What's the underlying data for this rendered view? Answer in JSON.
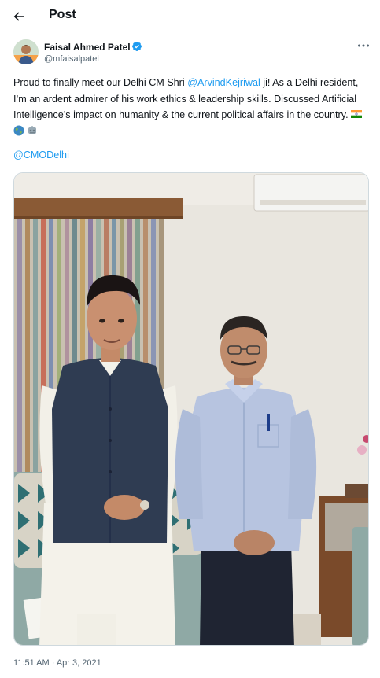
{
  "header": {
    "title": "Post",
    "back_icon": "arrow-left-icon"
  },
  "author": {
    "display_name": "Faisal Ahmed Patel",
    "handle": "@mfaisalpatel",
    "verified_icon": "verified-badge-icon",
    "verified_color": "#1d9bf0",
    "more_icon": "more-horizontal-icon"
  },
  "post": {
    "text_part1": "Proud to finally meet our Delhi CM Shri ",
    "mention1": "@ArvindKejriwal",
    "text_part2": " ji! As a Delhi resident, I’m an ardent admirer of his work ethics & leadership skills. Discussed Artificial Intelligence’s impact on humanity & the current political affairs in the country. ",
    "emojis": [
      "india-flag-icon",
      "globe-icon",
      "robot-icon"
    ],
    "mention2": "@CMODelhi",
    "timestamp": "11:51 AM · Apr 3, 2021"
  },
  "colors": {
    "link": "#1d9bf0",
    "text": "#0f1419",
    "secondary": "#536471",
    "border": "#cfd9de"
  }
}
